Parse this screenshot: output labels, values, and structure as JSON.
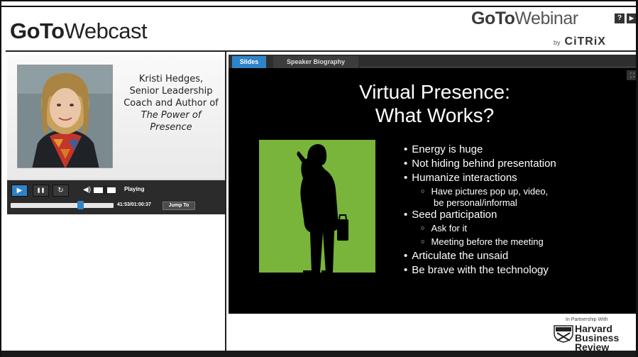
{
  "header": {
    "left_brand_bold": "GoTo",
    "left_brand_light": "Webcast",
    "right_brand_bold": "GoTo",
    "right_brand_light": "Webinar",
    "by_label": "by",
    "citrix_label": "CiTRiX",
    "help_icon_glyph": "?",
    "exit_icon_glyph": "▶"
  },
  "speaker": {
    "name": "Kristi Hedges,",
    "title_line": "Senior Leadership Coach and Author of",
    "book_title": "The Power of Presence"
  },
  "player": {
    "play_glyph": "▶",
    "pause_glyph": "❚❚",
    "refresh_glyph": "↻",
    "volume_glyph": "◀)",
    "status": "Playing",
    "time": "41:53/01:00:37",
    "jump_label": "Jump To",
    "progress_fraction": 0.69,
    "volume_fraction": 0.5
  },
  "tabs": [
    {
      "label": "Slides",
      "active": true
    },
    {
      "label": "Speaker Biography",
      "active": false
    }
  ],
  "slide": {
    "title_line1": "Virtual Presence:",
    "title_line2": "What Works?",
    "expand_glyph": "⛶",
    "bullets": [
      {
        "level": 1,
        "text": "Energy is huge"
      },
      {
        "level": 1,
        "text": "Not hiding behind presentation"
      },
      {
        "level": 1,
        "text": "Humanize interactions"
      },
      {
        "level": 2,
        "text": "Have pictures pop up, video,"
      },
      {
        "level": 3,
        "text": "be personal/informal"
      },
      {
        "level": 1,
        "text": "Seed participation"
      },
      {
        "level": 2,
        "text": "Ask for it"
      },
      {
        "level": 2,
        "text": "Meeting before the meeting"
      },
      {
        "level": 1,
        "text": "Articulate the unsaid"
      },
      {
        "level": 1,
        "text": "Be brave with the technology"
      }
    ]
  },
  "partner": {
    "label": "In Partnership With",
    "hbr_line1": "Harvard",
    "hbr_line2": "Business",
    "hbr_line3": "Review"
  },
  "colors": {
    "accent_blue": "#2f83c9",
    "slide_green": "#78b53a",
    "slide_bg": "#000000"
  }
}
